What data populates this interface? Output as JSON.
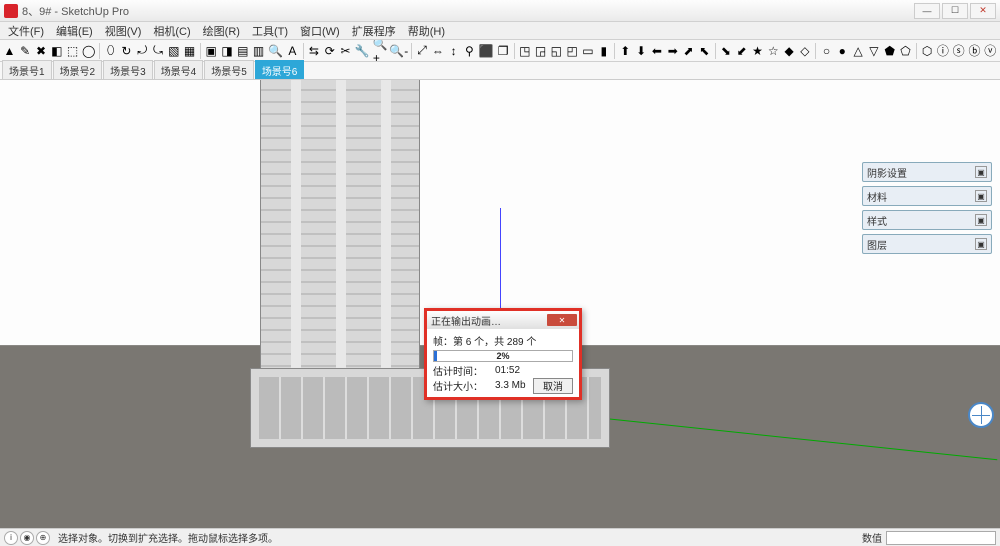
{
  "window": {
    "title": "8、9# - SketchUp Pro"
  },
  "menu": [
    "文件(F)",
    "编辑(E)",
    "视图(V)",
    "相机(C)",
    "绘图(R)",
    "工具(T)",
    "窗口(W)",
    "扩展程序",
    "帮助(H)"
  ],
  "scene_tabs": [
    "场景号1",
    "场景号2",
    "场景号3",
    "场景号4",
    "场景号5",
    "场景号6"
  ],
  "scene_active_index": 5,
  "panels": [
    "阴影设置",
    "材料",
    "样式",
    "图层"
  ],
  "dialog": {
    "title": "正在输出动画…",
    "frame_label": "帧：第 6 个，共 289 个",
    "percent": "2%",
    "est_time_label": "估计时间：",
    "est_time_value": "01:52",
    "est_size_label": "估计大小：",
    "est_size_value": "3.3 Mb",
    "cancel": "取消"
  },
  "status": {
    "help": "选择对象。切换到扩充选择。拖动鼠标选择多项。",
    "label": "数值"
  },
  "tool_icons": [
    "▲",
    "✎",
    "✖",
    "◧",
    "⬚",
    "◯",
    "⬯",
    "↻",
    "⤾",
    "⤿",
    "▧",
    "▦",
    "▣",
    "◨",
    "▤",
    "▥",
    "🔍",
    "A",
    "⇆",
    "⟳",
    "✂",
    "🔧",
    "🔍+",
    "🔍-",
    "⤢",
    "⇔",
    "↕",
    "⚲",
    "⬛",
    "❐",
    "◳",
    "◲",
    "◱",
    "◰",
    "▭",
    "▮",
    "⬆",
    "⬇",
    "⬅",
    "➡",
    "⬈",
    "⬉",
    "⬊",
    "⬋",
    "★",
    "☆",
    "◆",
    "◇",
    "○",
    "●",
    "△",
    "▽",
    "⬟",
    "⬠",
    "⬡",
    "ⓘ",
    "ⓢ",
    "ⓑ",
    "ⓥ"
  ]
}
